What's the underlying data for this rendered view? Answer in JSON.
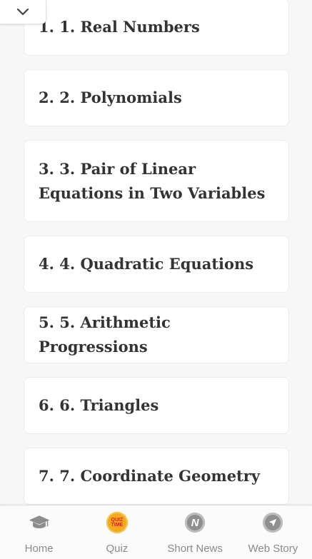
{
  "chapters": [
    {
      "label": "1. 1. Real Numbers"
    },
    {
      "label": "2. 2. Polynomials"
    },
    {
      "label": "3. 3. Pair of Linear Equations in Two Variables"
    },
    {
      "label": "4. 4. Quadratic Equations"
    },
    {
      "label": "5. 5. Arithmetic Progressions"
    },
    {
      "label": "6. 6. Triangles"
    },
    {
      "label": "7. 7. Coordinate Geometry"
    }
  ],
  "collapse": {
    "icon": "chevron-down-icon"
  },
  "nav": {
    "home": {
      "label": "Home",
      "icon": "graduation-cap-icon"
    },
    "quiz": {
      "label": "Quiz",
      "icon": "quiz-time-icon",
      "badge_line1": "QUIZ",
      "badge_line2": "TIME"
    },
    "short_news": {
      "label": "Short News",
      "icon": "n-logo-icon",
      "glyph": "N"
    },
    "web_story": {
      "label": "Web Story",
      "icon": "navigation-arrow-icon"
    }
  }
}
